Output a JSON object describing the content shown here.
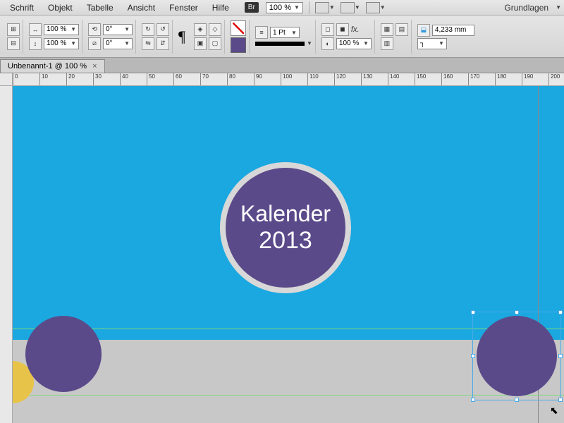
{
  "menu": {
    "items": [
      "Schrift",
      "Objekt",
      "Tabelle",
      "Ansicht",
      "Fenster",
      "Hilfe"
    ],
    "bridge": "Br",
    "zoom": "100 %",
    "workspace": "Grundlagen"
  },
  "control": {
    "scale_x": "100 %",
    "scale_y": "100 %",
    "rotate": "0°",
    "shear": "0°",
    "para_icon": "¶",
    "stroke_weight": "1 Pt",
    "opacity": "100 %",
    "fx": "fx.",
    "measure": "4,233 mm"
  },
  "document": {
    "tab_title": "Unbenannt-1 @ 100 %",
    "close": "×"
  },
  "ruler": {
    "marks": [
      "0",
      "10",
      "20",
      "30",
      "40",
      "50",
      "60",
      "70",
      "80",
      "90",
      "100",
      "110",
      "120",
      "130",
      "140",
      "150",
      "160",
      "170",
      "180",
      "190",
      "200"
    ]
  },
  "artwork": {
    "title_line1": "Kalender",
    "title_line2": "2013",
    "colors": {
      "sky": "#1ba8e0",
      "purple": "#5b4a8a",
      "yellow": "#e8c34a"
    }
  }
}
